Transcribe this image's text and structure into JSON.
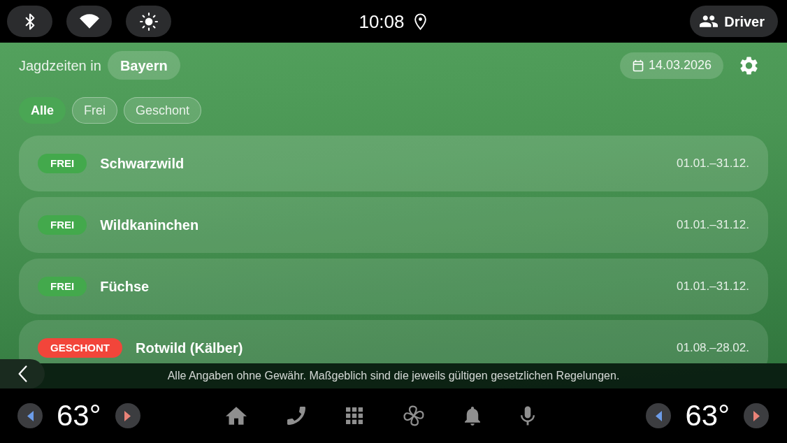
{
  "status_bar": {
    "time": "10:08",
    "profile_button": "Driver"
  },
  "header": {
    "title": "Jagdzeiten in",
    "region": "Bayern",
    "date": "14.03.2026"
  },
  "filters": [
    {
      "label": "Alle",
      "selected": true
    },
    {
      "label": "Frei",
      "selected": false
    },
    {
      "label": "Geschont",
      "selected": false
    }
  ],
  "seasons": [
    {
      "kind": "open",
      "status": "FREI",
      "name": "Schwarzwild",
      "period": "01.01.–31.12."
    },
    {
      "kind": "open",
      "status": "FREI",
      "name": "Wildkaninchen",
      "period": "01.01.–31.12."
    },
    {
      "kind": "open",
      "status": "FREI",
      "name": "Füchse",
      "period": "01.01.–31.12."
    },
    {
      "kind": "protected",
      "status": "GESCHONT",
      "name": "Rotwild (Kälber)",
      "period": "01.08.–28.02."
    }
  ],
  "disclaimer": "Alle Angaben ohne Gewähr. Maßgeblich sind die jeweils gültigen gesetzlichen Regelungen.",
  "climate": {
    "left_temp": "63°",
    "right_temp": "63°"
  }
}
